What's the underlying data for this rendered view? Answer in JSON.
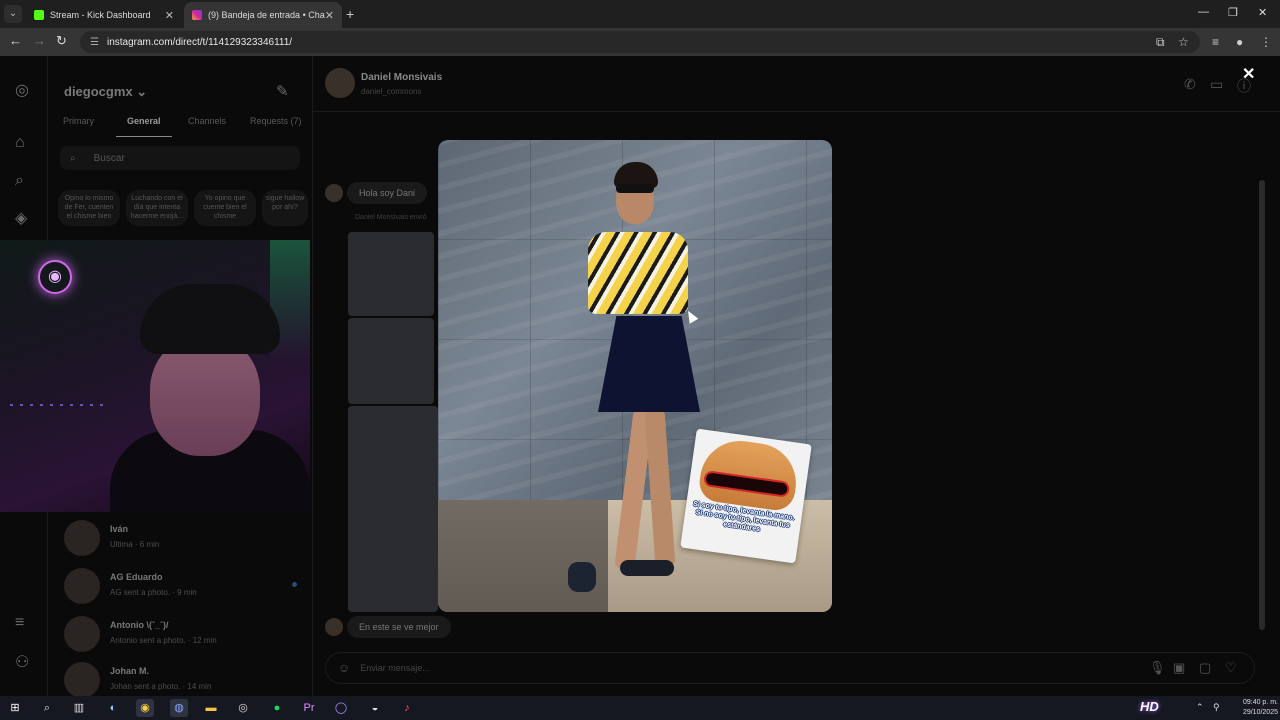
{
  "browser": {
    "tabs": [
      {
        "title": "Stream - Kick Dashboard",
        "favicon_color": "#53fc18",
        "active": false
      },
      {
        "title": "(9) Bandeja de entrada • Chats",
        "favicon_color": "#d6249f",
        "active": true
      }
    ],
    "url": "instagram.com/direct/t/114129323346111/",
    "close_glyph": "✕",
    "new_tab_glyph": "+"
  },
  "sidebar_rail": {
    "icons": [
      "instagram-icon",
      "home-icon",
      "search-icon",
      "explore-icon",
      "menu-icon",
      "threads-icon"
    ]
  },
  "inbox": {
    "username": "diegocgmx",
    "filter_tabs": [
      "Primary",
      "General",
      "Channels",
      "Requests (7)"
    ],
    "active_filter": "General",
    "search_placeholder": "Buscar",
    "notes": [
      "Opino lo mismo de Fer, cuenten el chisme bien",
      "Luchando con el día que intenta hacerme enojá...",
      "Yo opino que cuente bien el chisme",
      "sigue hallow por ahí?"
    ],
    "chats": [
      {
        "name": "Iván",
        "preview": "Ultima · 6 min"
      },
      {
        "name": "AG Eduardo",
        "preview": "AG sent a photo. · 9 min"
      },
      {
        "name": "Antonio \\(ˉ_ˉ)/",
        "preview": "Antonio sent a photo. · 12 min"
      },
      {
        "name": "Johan M.",
        "preview": "Johan sent a photo. · 14 min"
      }
    ]
  },
  "conversation": {
    "name": "Daniel Monsivais",
    "handle": "daniel_commons",
    "messages": [
      {
        "text": "Hola soy Dani"
      },
      {
        "text": "En este se ve mejor"
      }
    ],
    "sent_note": "Daniel Monsivais envió",
    "composer_placeholder": "Enviar mensaje...",
    "close_glyph": "✕"
  },
  "sticker": {
    "caption": "Si soy tu tipo, levanta la mano. Si no soy tu tipo, levanta tus estándares"
  },
  "taskbar": {
    "time": "09:40 p. m.",
    "date": "29/10/2025",
    "overlay_logo": "HD"
  }
}
